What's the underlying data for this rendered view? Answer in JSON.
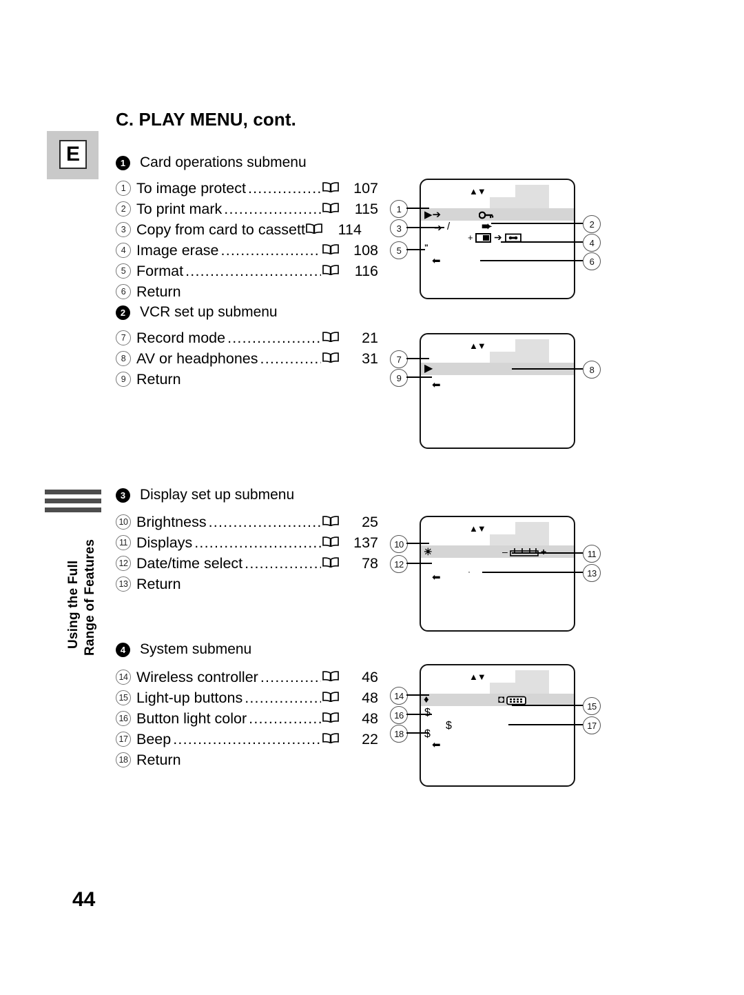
{
  "page": {
    "title": "C. PLAY MENU, cont.",
    "language_badge": "E",
    "page_number": "44",
    "side_tab": {
      "line1": "Using the Full",
      "line2": "Range of Features"
    }
  },
  "sections": [
    {
      "marker": "1",
      "heading": "Card operations submenu",
      "items": [
        {
          "num": "1",
          "label": "To image protect",
          "icon": "book-icon",
          "page": "107",
          "truncated": false
        },
        {
          "num": "2",
          "label": "To print mark",
          "icon": "book-icon",
          "page": "115",
          "truncated": false
        },
        {
          "num": "3",
          "label": "Copy from card to cassett",
          "icon": "book-icon",
          "page": "114",
          "truncated": true
        },
        {
          "num": "4",
          "label": "Image erase",
          "icon": "book-icon",
          "page": "108",
          "truncated": false
        },
        {
          "num": "5",
          "label": "Format",
          "icon": "book-icon",
          "page": "116",
          "truncated": false
        },
        {
          "num": "6",
          "label": "Return",
          "icon": "",
          "page": "",
          "truncated": false
        }
      ]
    },
    {
      "marker": "2",
      "heading": "VCR set up submenu",
      "items": [
        {
          "num": "7",
          "label": "Record mode",
          "icon": "book-icon",
          "page": "21",
          "truncated": false
        },
        {
          "num": "8",
          "label": "AV or headphones",
          "icon": "book-icon",
          "page": "31",
          "truncated": false
        },
        {
          "num": "9",
          "label": "Return",
          "icon": "",
          "page": "",
          "truncated": false
        }
      ]
    },
    {
      "marker": "3",
      "heading": "Display set up submenu",
      "items": [
        {
          "num": "10",
          "label": "Brightness",
          "icon": "book-icon",
          "page": "25",
          "truncated": false
        },
        {
          "num": "11",
          "label": "Displays",
          "icon": "book-icon",
          "page": "137",
          "truncated": false
        },
        {
          "num": "12",
          "label": "Date/time select",
          "icon": "book-icon",
          "page": "78",
          "truncated": false
        },
        {
          "num": "13",
          "label": "Return",
          "icon": "",
          "page": "",
          "truncated": false
        }
      ]
    },
    {
      "marker": "4",
      "heading": "System submenu",
      "items": [
        {
          "num": "14",
          "label": "Wireless controller",
          "icon": "book-icon",
          "page": "46",
          "truncated": false
        },
        {
          "num": "15",
          "label": "Light-up buttons",
          "icon": "book-icon",
          "page": "48",
          "truncated": false
        },
        {
          "num": "16",
          "label": "Button light color",
          "icon": "book-icon",
          "page": "48",
          "truncated": false
        },
        {
          "num": "17",
          "label": "Beep",
          "icon": "book-icon",
          "page": "22",
          "truncated": false
        },
        {
          "num": "18",
          "label": "Return",
          "icon": "",
          "page": "",
          "truncated": false
        }
      ]
    }
  ],
  "diagrams": [
    {
      "name": "card-operations-screen",
      "scroll_indicator": "▲▼",
      "callouts_left": [
        "1",
        "3",
        "5"
      ],
      "callouts_right": [
        "2",
        "4",
        "6"
      ],
      "glyphs": [
        "play-arrow-icon",
        "right-arrow-icon",
        "key-icon",
        "print-mark-icon",
        "card-to-cassette-icon",
        "quote-icon",
        "return-arrow-icon"
      ]
    },
    {
      "name": "vcr-setup-screen",
      "scroll_indicator": "▲▼",
      "callouts_left": [
        "7",
        "9"
      ],
      "callouts_right": [
        "8"
      ],
      "glyphs": [
        "play-arrow-icon",
        "return-arrow-icon"
      ]
    },
    {
      "name": "display-setup-screen",
      "scroll_indicator": "▲▼",
      "callouts_left": [
        "10",
        "12"
      ],
      "callouts_right": [
        "11",
        "13"
      ],
      "glyphs": [
        "brightness-icon",
        "brightness-slider",
        "return-arrow-icon"
      ],
      "slider_minus": "–",
      "slider_plus": "+"
    },
    {
      "name": "system-setup-screen",
      "scroll_indicator": "▲▼",
      "callouts_left": [
        "14",
        "16",
        "18"
      ],
      "callouts_right": [
        "15",
        "17"
      ],
      "glyphs": [
        "wireless-controller-icon",
        "remote-sensor-icon",
        "return-arrow-icon"
      ],
      "dollar_marks": [
        "$",
        "$",
        "$"
      ]
    }
  ]
}
